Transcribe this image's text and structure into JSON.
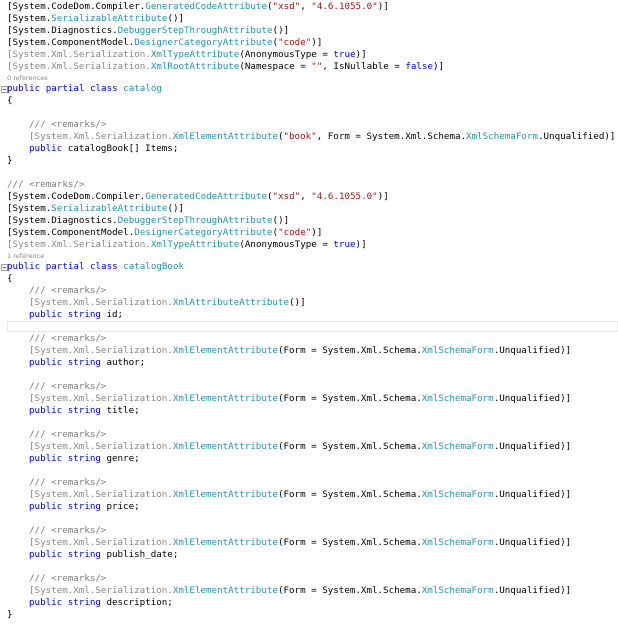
{
  "editor": {
    "lines": [
      {
        "kind": "code",
        "indent": 0,
        "tokens": [
          {
            "t": "pl",
            "v": "[System.CodeDom.Compiler."
          },
          {
            "t": "attr",
            "v": "GeneratedCodeAttribute"
          },
          {
            "t": "pl",
            "v": "("
          },
          {
            "t": "str",
            "v": "\"xsd\""
          },
          {
            "t": "pl",
            "v": ", "
          },
          {
            "t": "str",
            "v": "\"4.6.1055.0\""
          },
          {
            "t": "pl",
            "v": ")]"
          }
        ]
      },
      {
        "kind": "code",
        "indent": 0,
        "tokens": [
          {
            "t": "pl",
            "v": "[System."
          },
          {
            "t": "attr",
            "v": "SerializableAttribute"
          },
          {
            "t": "pl",
            "v": "()]"
          }
        ]
      },
      {
        "kind": "code",
        "indent": 0,
        "tokens": [
          {
            "t": "pl",
            "v": "[System.Diagnostics."
          },
          {
            "t": "attr",
            "v": "DebuggerStepThroughAttribute"
          },
          {
            "t": "pl",
            "v": "()]"
          }
        ]
      },
      {
        "kind": "code",
        "indent": 0,
        "tokens": [
          {
            "t": "pl",
            "v": "[System.ComponentModel."
          },
          {
            "t": "attr",
            "v": "DesignerCategoryAttribute"
          },
          {
            "t": "pl",
            "v": "("
          },
          {
            "t": "str",
            "v": "\"code\""
          },
          {
            "t": "pl",
            "v": ")]"
          }
        ]
      },
      {
        "kind": "code",
        "indent": 0,
        "tokens": [
          {
            "t": "gray",
            "v": "[System.Xml.Serialization."
          },
          {
            "t": "attr",
            "v": "XmlTypeAttribute"
          },
          {
            "t": "pl",
            "v": "(AnonymousType = "
          },
          {
            "t": "kw",
            "v": "true"
          },
          {
            "t": "pl",
            "v": ")]"
          }
        ]
      },
      {
        "kind": "code",
        "indent": 0,
        "tokens": [
          {
            "t": "gray",
            "v": "[System.Xml.Serialization."
          },
          {
            "t": "attr",
            "v": "XmlRootAttribute"
          },
          {
            "t": "pl",
            "v": "(Namespace = "
          },
          {
            "t": "str",
            "v": "\"\""
          },
          {
            "t": "pl",
            "v": ", IsNullable = "
          },
          {
            "t": "kw",
            "v": "false"
          },
          {
            "t": "pl",
            "v": ")]"
          }
        ]
      },
      {
        "kind": "lens",
        "text": "0 references"
      },
      {
        "kind": "code",
        "indent": 0,
        "fold": true,
        "tokens": [
          {
            "t": "kw",
            "v": "public partial class "
          },
          {
            "t": "type",
            "v": "catalog"
          }
        ]
      },
      {
        "kind": "code",
        "indent": 0,
        "tokens": [
          {
            "t": "pl",
            "v": "{"
          }
        ]
      },
      {
        "kind": "code",
        "indent": 0,
        "tokens": []
      },
      {
        "kind": "code",
        "indent": 1,
        "tokens": [
          {
            "t": "cmt",
            "v": "/// <remarks/>"
          }
        ]
      },
      {
        "kind": "code",
        "indent": 1,
        "tokens": [
          {
            "t": "gray",
            "v": "[System.Xml.Serialization."
          },
          {
            "t": "attr",
            "v": "XmlElementAttribute"
          },
          {
            "t": "pl",
            "v": "("
          },
          {
            "t": "str",
            "v": "\"book\""
          },
          {
            "t": "pl",
            "v": ", Form = System.Xml.Schema."
          },
          {
            "t": "type",
            "v": "XmlSchemaForm"
          },
          {
            "t": "pl",
            "v": ".Unqualified)]"
          }
        ]
      },
      {
        "kind": "code",
        "indent": 1,
        "tokens": [
          {
            "t": "kw",
            "v": "public "
          },
          {
            "t": "pl",
            "v": "catalogBook[] Items;"
          }
        ]
      },
      {
        "kind": "code",
        "indent": 0,
        "tokens": [
          {
            "t": "pl",
            "v": "}"
          }
        ]
      },
      {
        "kind": "code",
        "indent": 0,
        "tokens": []
      },
      {
        "kind": "code",
        "indent": 0,
        "tokens": [
          {
            "t": "cmt",
            "v": "/// <remarks/>"
          }
        ]
      },
      {
        "kind": "code",
        "indent": 0,
        "tokens": [
          {
            "t": "pl",
            "v": "[System.CodeDom.Compiler."
          },
          {
            "t": "attr",
            "v": "GeneratedCodeAttribute"
          },
          {
            "t": "pl",
            "v": "("
          },
          {
            "t": "str",
            "v": "\"xsd\""
          },
          {
            "t": "pl",
            "v": ", "
          },
          {
            "t": "str",
            "v": "\"4.6.1055.0\""
          },
          {
            "t": "pl",
            "v": ")]"
          }
        ]
      },
      {
        "kind": "code",
        "indent": 0,
        "tokens": [
          {
            "t": "pl",
            "v": "[System."
          },
          {
            "t": "attr",
            "v": "SerializableAttribute"
          },
          {
            "t": "pl",
            "v": "()]"
          }
        ]
      },
      {
        "kind": "code",
        "indent": 0,
        "tokens": [
          {
            "t": "pl",
            "v": "[System.Diagnostics."
          },
          {
            "t": "attr",
            "v": "DebuggerStepThroughAttribute"
          },
          {
            "t": "pl",
            "v": "()]"
          }
        ]
      },
      {
        "kind": "code",
        "indent": 0,
        "tokens": [
          {
            "t": "pl",
            "v": "[System.ComponentModel."
          },
          {
            "t": "attr",
            "v": "DesignerCategoryAttribute"
          },
          {
            "t": "pl",
            "v": "("
          },
          {
            "t": "str",
            "v": "\"code\""
          },
          {
            "t": "pl",
            "v": ")]"
          }
        ]
      },
      {
        "kind": "code",
        "indent": 0,
        "tokens": [
          {
            "t": "gray",
            "v": "[System.Xml.Serialization."
          },
          {
            "t": "attr",
            "v": "XmlTypeAttribute"
          },
          {
            "t": "pl",
            "v": "(AnonymousType = "
          },
          {
            "t": "kw",
            "v": "true"
          },
          {
            "t": "pl",
            "v": ")]"
          }
        ]
      },
      {
        "kind": "lens",
        "text": "1 reference"
      },
      {
        "kind": "code",
        "indent": 0,
        "fold": true,
        "tokens": [
          {
            "t": "kw",
            "v": "public partial class "
          },
          {
            "t": "type",
            "v": "catalogBook"
          }
        ]
      },
      {
        "kind": "code",
        "indent": 0,
        "tokens": [
          {
            "t": "pl",
            "v": "{"
          }
        ]
      },
      {
        "kind": "code",
        "indent": 1,
        "tokens": [
          {
            "t": "cmt",
            "v": "/// <remarks/>"
          }
        ]
      },
      {
        "kind": "code",
        "indent": 1,
        "tokens": [
          {
            "t": "gray",
            "v": "[System.Xml.Serialization."
          },
          {
            "t": "attr",
            "v": "XmlAttributeAttribute"
          },
          {
            "t": "pl",
            "v": "()]"
          }
        ]
      },
      {
        "kind": "code",
        "indent": 1,
        "tokens": [
          {
            "t": "kw",
            "v": "public string "
          },
          {
            "t": "pl",
            "v": "id;"
          }
        ]
      },
      {
        "kind": "code",
        "indent": 0,
        "current": true,
        "tokens": []
      },
      {
        "kind": "code",
        "indent": 1,
        "tokens": [
          {
            "t": "cmt",
            "v": "/// <remarks/>"
          }
        ]
      },
      {
        "kind": "code",
        "indent": 1,
        "tokens": [
          {
            "t": "gray",
            "v": "[System.Xml.Serialization."
          },
          {
            "t": "attr",
            "v": "XmlElementAttribute"
          },
          {
            "t": "pl",
            "v": "(Form = System.Xml.Schema."
          },
          {
            "t": "type",
            "v": "XmlSchemaForm"
          },
          {
            "t": "pl",
            "v": ".Unqualified)]"
          }
        ]
      },
      {
        "kind": "code",
        "indent": 1,
        "tokens": [
          {
            "t": "kw",
            "v": "public string "
          },
          {
            "t": "pl",
            "v": "author;"
          }
        ]
      },
      {
        "kind": "code",
        "indent": 0,
        "tokens": []
      },
      {
        "kind": "code",
        "indent": 1,
        "tokens": [
          {
            "t": "cmt",
            "v": "/// <remarks/>"
          }
        ]
      },
      {
        "kind": "code",
        "indent": 1,
        "tokens": [
          {
            "t": "gray",
            "v": "[System.Xml.Serialization."
          },
          {
            "t": "attr",
            "v": "XmlElementAttribute"
          },
          {
            "t": "pl",
            "v": "(Form = System.Xml.Schema."
          },
          {
            "t": "type",
            "v": "XmlSchemaForm"
          },
          {
            "t": "pl",
            "v": ".Unqualified)]"
          }
        ]
      },
      {
        "kind": "code",
        "indent": 1,
        "tokens": [
          {
            "t": "kw",
            "v": "public string "
          },
          {
            "t": "pl",
            "v": "title;"
          }
        ]
      },
      {
        "kind": "code",
        "indent": 0,
        "tokens": []
      },
      {
        "kind": "code",
        "indent": 1,
        "tokens": [
          {
            "t": "cmt",
            "v": "/// <remarks/>"
          }
        ]
      },
      {
        "kind": "code",
        "indent": 1,
        "tokens": [
          {
            "t": "gray",
            "v": "[System.Xml.Serialization."
          },
          {
            "t": "attr",
            "v": "XmlElementAttribute"
          },
          {
            "t": "pl",
            "v": "(Form = System.Xml.Schema."
          },
          {
            "t": "type",
            "v": "XmlSchemaForm"
          },
          {
            "t": "pl",
            "v": ".Unqualified)]"
          }
        ]
      },
      {
        "kind": "code",
        "indent": 1,
        "tokens": [
          {
            "t": "kw",
            "v": "public string "
          },
          {
            "t": "pl",
            "v": "genre;"
          }
        ]
      },
      {
        "kind": "code",
        "indent": 0,
        "tokens": []
      },
      {
        "kind": "code",
        "indent": 1,
        "tokens": [
          {
            "t": "cmt",
            "v": "/// <remarks/>"
          }
        ]
      },
      {
        "kind": "code",
        "indent": 1,
        "tokens": [
          {
            "t": "gray",
            "v": "[System.Xml.Serialization."
          },
          {
            "t": "attr",
            "v": "XmlElementAttribute"
          },
          {
            "t": "pl",
            "v": "(Form = System.Xml.Schema."
          },
          {
            "t": "type",
            "v": "XmlSchemaForm"
          },
          {
            "t": "pl",
            "v": ".Unqualified)]"
          }
        ]
      },
      {
        "kind": "code",
        "indent": 1,
        "tokens": [
          {
            "t": "kw",
            "v": "public string "
          },
          {
            "t": "pl",
            "v": "price;"
          }
        ]
      },
      {
        "kind": "code",
        "indent": 0,
        "tokens": []
      },
      {
        "kind": "code",
        "indent": 1,
        "tokens": [
          {
            "t": "cmt",
            "v": "/// <remarks/>"
          }
        ]
      },
      {
        "kind": "code",
        "indent": 1,
        "tokens": [
          {
            "t": "gray",
            "v": "[System.Xml.Serialization."
          },
          {
            "t": "attr",
            "v": "XmlElementAttribute"
          },
          {
            "t": "pl",
            "v": "(Form = System.Xml.Schema."
          },
          {
            "t": "type",
            "v": "XmlSchemaForm"
          },
          {
            "t": "pl",
            "v": ".Unqualified)]"
          }
        ]
      },
      {
        "kind": "code",
        "indent": 1,
        "tokens": [
          {
            "t": "kw",
            "v": "public string "
          },
          {
            "t": "pl",
            "v": "publish_date;"
          }
        ]
      },
      {
        "kind": "code",
        "indent": 0,
        "tokens": []
      },
      {
        "kind": "code",
        "indent": 1,
        "tokens": [
          {
            "t": "cmt",
            "v": "/// <remarks/>"
          }
        ]
      },
      {
        "kind": "code",
        "indent": 1,
        "tokens": [
          {
            "t": "gray",
            "v": "[System.Xml.Serialization."
          },
          {
            "t": "attr",
            "v": "XmlElementAttribute"
          },
          {
            "t": "pl",
            "v": "(Form = System.Xml.Schema."
          },
          {
            "t": "type",
            "v": "XmlSchemaForm"
          },
          {
            "t": "pl",
            "v": ".Unqualified)]"
          }
        ]
      },
      {
        "kind": "code",
        "indent": 1,
        "tokens": [
          {
            "t": "kw",
            "v": "public string "
          },
          {
            "t": "pl",
            "v": "description;"
          }
        ]
      },
      {
        "kind": "code",
        "indent": 0,
        "tokens": [
          {
            "t": "pl",
            "v": "}"
          }
        ]
      }
    ]
  },
  "colors": {
    "keyword": "#0000ff",
    "type": "#2b91af",
    "string": "#a31515",
    "comment": "#808080",
    "namespace_gray": "#8a8a8a",
    "background": "#ffffff"
  }
}
